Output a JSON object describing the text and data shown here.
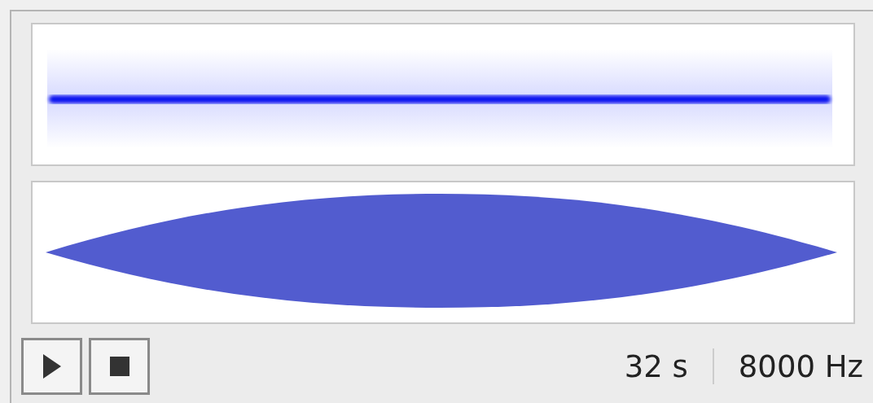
{
  "transport": {
    "buttons": [
      {
        "kind": "play"
      },
      {
        "kind": "stop"
      }
    ]
  },
  "duration": "32 s",
  "sample_rate": "8000 Hz"
}
